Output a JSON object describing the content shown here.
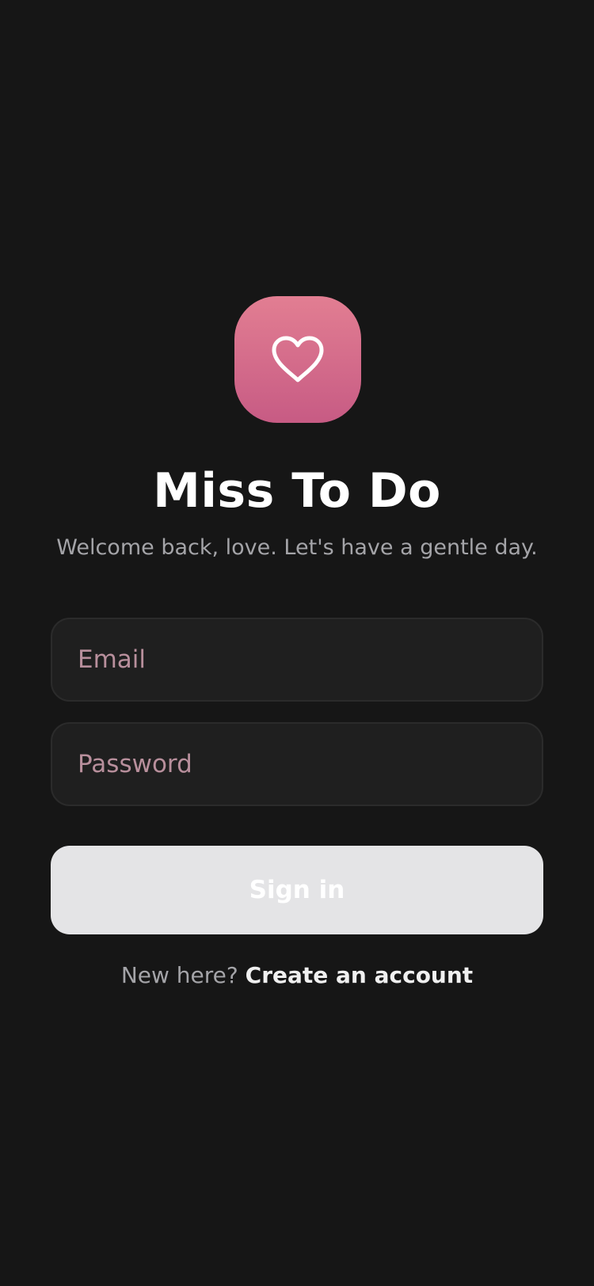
{
  "app": {
    "title": "Miss To Do",
    "subtitle": "Welcome back, love. Let's have a gentle day.",
    "icon": "heart-icon",
    "brand_gradient": [
      "#e27e92",
      "#c75b84"
    ]
  },
  "form": {
    "email_placeholder": "Email",
    "email_value": "",
    "password_placeholder": "Password",
    "password_value": "",
    "submit_label": "Sign in"
  },
  "footer": {
    "prompt": "New here?",
    "link_label": "Create an account"
  }
}
